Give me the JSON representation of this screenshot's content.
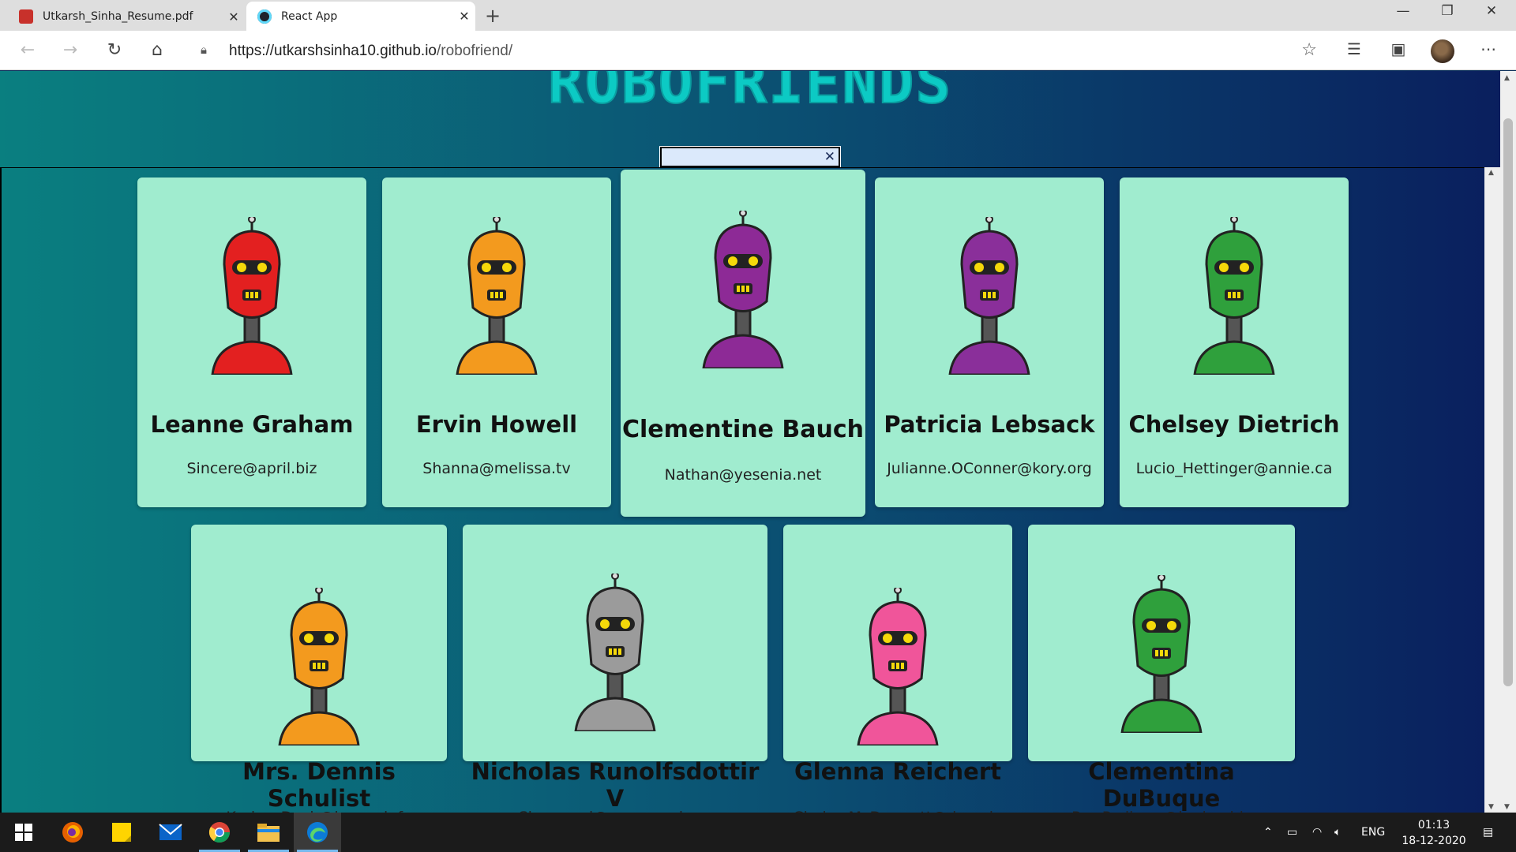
{
  "browser": {
    "tabs": [
      {
        "title": "Utkarsh_Sinha_Resume.pdf",
        "active": false
      },
      {
        "title": "React App",
        "active": true
      }
    ],
    "url_host": "https://utkarshsinha10.github.io",
    "url_path": "/robofriend/"
  },
  "page": {
    "title": "ROBOFRIENDS",
    "search": {
      "value": "",
      "clear_symbol": "✕"
    }
  },
  "robots": [
    {
      "name": "Leanne Graham",
      "email": "Sincere@april.biz",
      "color": "#e32020"
    },
    {
      "name": "Ervin Howell",
      "email": "Shanna@melissa.tv",
      "color": "#f39a1e"
    },
    {
      "name": "Clementine Bauch",
      "email": "Nathan@yesenia.net",
      "color": "#8d2a96"
    },
    {
      "name": "Patricia Lebsack",
      "email": "Julianne.OConner@kory.org",
      "color": "#8a2f9a"
    },
    {
      "name": "Chelsey Dietrich",
      "email": "Lucio_Hettinger@annie.ca",
      "color": "#2fa03c"
    },
    {
      "name": "Mrs. Dennis Schulist",
      "email": "Karley_Dach@jasper.info",
      "color": "#f39a1e"
    },
    {
      "name": "Nicholas Runolfsdottir V",
      "email": "Sherwood@rosamond.me",
      "color": "#9b9b9b"
    },
    {
      "name": "Glenna Reichert",
      "email": "Chaim_McDermott@dana.io",
      "color": "#f0559a"
    },
    {
      "name": "Clementina DuBuque",
      "email": "Rey.Padberg@karina.biz",
      "color": "#2fa03c"
    }
  ],
  "taskbar": {
    "apps": [
      "start",
      "firefox",
      "sticky-notes",
      "mail",
      "chrome",
      "file-explorer",
      "edge"
    ],
    "language": "ENG",
    "time": "01:13",
    "date": "18-12-2020"
  }
}
